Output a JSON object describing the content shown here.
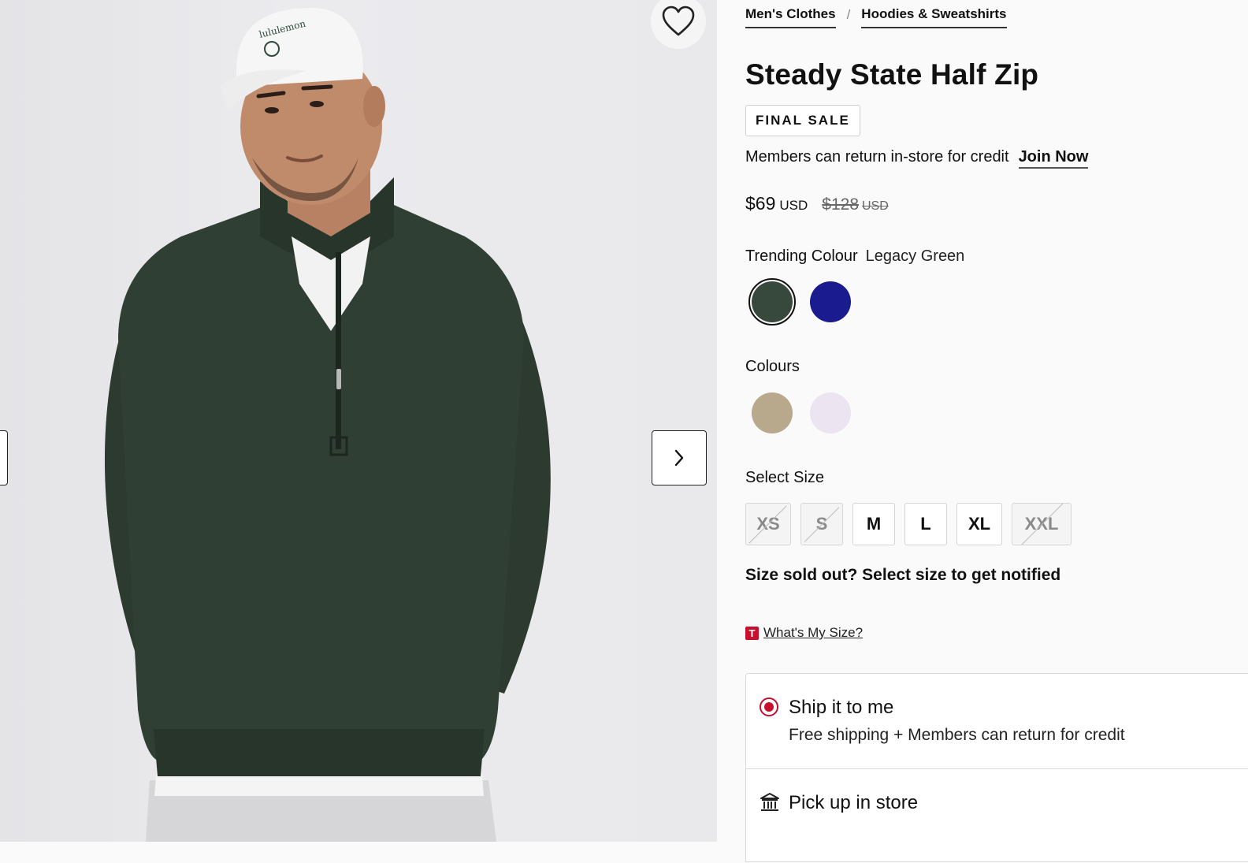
{
  "breadcrumb": {
    "items": [
      "Men's Clothes",
      "Hoodies & Sweatshirts"
    ],
    "separator": "/"
  },
  "product": {
    "title": "Steady State Half Zip",
    "badge": "FINAL SALE",
    "returns_text": "Members can return in-store for credit",
    "join_label": "Join Now",
    "price": {
      "current": "$69",
      "current_currency": "USD",
      "original": "$128",
      "original_currency": "USD"
    }
  },
  "trending_colour": {
    "label": "Trending Colour",
    "selected_name": "Legacy Green",
    "swatches": [
      {
        "name": "Legacy Green",
        "color": "#37483d",
        "selected": true
      },
      {
        "name": "Navy",
        "color": "#1a1b8f",
        "selected": false
      }
    ]
  },
  "colours": {
    "label": "Colours",
    "swatches": [
      {
        "name": "Khaki",
        "color": "#b8a88c"
      },
      {
        "name": "Lilac",
        "color": "#ece4f0"
      }
    ]
  },
  "size": {
    "label": "Select Size",
    "options": [
      {
        "label": "XS",
        "available": false
      },
      {
        "label": "S",
        "available": false
      },
      {
        "label": "M",
        "available": true
      },
      {
        "label": "L",
        "available": true
      },
      {
        "label": "XL",
        "available": true
      },
      {
        "label": "XXL",
        "available": false
      }
    ],
    "sold_out_note": "Size sold out? Select size to get notified",
    "guide_logo": "T",
    "guide_link": "What's My Size?"
  },
  "fulfilment": {
    "ship": {
      "title": "Ship it to me",
      "subtitle": "Free shipping + Members can return for credit",
      "selected": true
    },
    "pickup": {
      "title": "Pick up in store"
    }
  },
  "icons": {
    "wishlist": "heart-icon",
    "next": "chevron-right-icon",
    "store": "store-icon"
  },
  "colors": {
    "accent": "#c8102e",
    "text": "#111111"
  }
}
